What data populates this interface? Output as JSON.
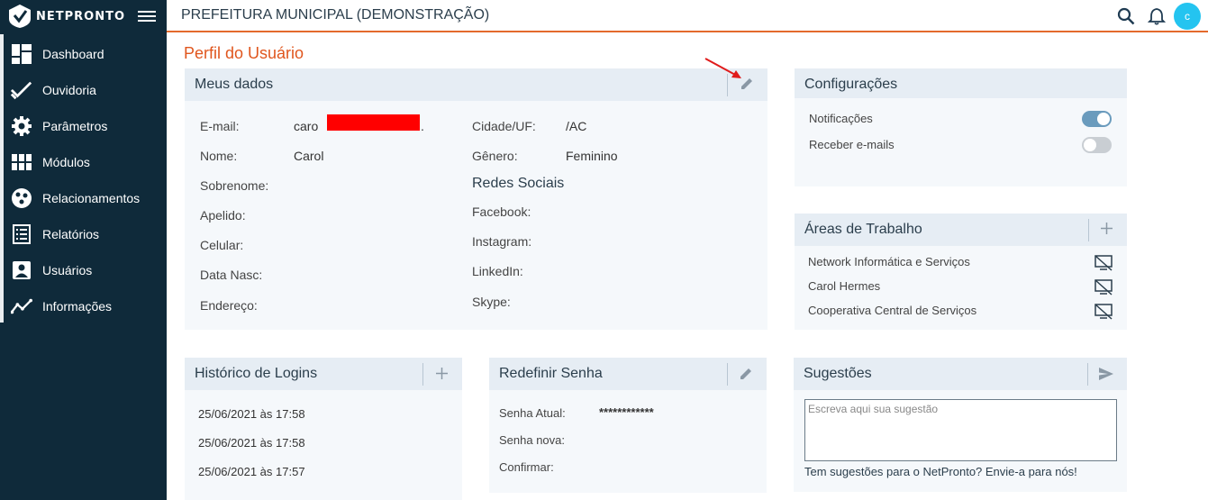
{
  "brand": {
    "name": "NETPRONTO"
  },
  "sidebar": {
    "items": [
      {
        "label": "Dashboard",
        "icon": "dashboard-icon"
      },
      {
        "label": "Ouvidoria",
        "icon": "checkmark-icon"
      },
      {
        "label": "Parâmetros",
        "icon": "gear-icon"
      },
      {
        "label": "Módulos",
        "icon": "grid-icon"
      },
      {
        "label": "Relacionamentos",
        "icon": "network-icon"
      },
      {
        "label": "Relatórios",
        "icon": "report-list-icon"
      },
      {
        "label": "Usuários",
        "icon": "user-icon"
      },
      {
        "label": "Informações",
        "icon": "line-chart-icon"
      }
    ]
  },
  "header": {
    "title": "PREFEITURA MUNICIPAL (DEMONSTRAÇÃO)",
    "avatar_letter": "c"
  },
  "page": {
    "title": "Perfil do Usuário"
  },
  "meus_dados": {
    "title": "Meus dados",
    "labels": {
      "email": "E-mail:",
      "nome": "Nome:",
      "sobrenome": "Sobrenome:",
      "apelido": "Apelido:",
      "celular": "Celular:",
      "data_nasc": "Data Nasc:",
      "endereco": "Endereço:",
      "cidade": "Cidade/UF:",
      "genero": "Gênero:"
    },
    "values": {
      "email_start": "caro",
      "email_end": ".",
      "nome": "Carol",
      "cidade": "/AC",
      "genero": "Feminino"
    },
    "redes_title": "Redes Sociais",
    "redes": {
      "facebook": "Facebook:",
      "instagram": "Instagram:",
      "linkedin": "LinkedIn:",
      "skype": "Skype:"
    }
  },
  "configuracoes": {
    "title": "Configurações",
    "items": [
      {
        "label": "Notificações",
        "on": true
      },
      {
        "label": "Receber e-mails",
        "on": false
      }
    ]
  },
  "areas": {
    "title": "Áreas de Trabalho",
    "items": [
      "Network Informática e Serviços",
      "Carol Hermes",
      "Cooperativa Central de Serviços"
    ]
  },
  "historico": {
    "title": "Histórico de Logins",
    "items": [
      "25/06/2021 às 17:58",
      "25/06/2021 às 17:58",
      "25/06/2021 às 17:57"
    ]
  },
  "senha": {
    "title": "Redefinir Senha",
    "atual_label": "Senha Atual:",
    "atual_value": "************",
    "nova_label": "Senha nova:",
    "confirmar_label": "Confirmar:"
  },
  "sugestoes": {
    "title": "Sugestões",
    "placeholder": "Escreva aqui sua sugestão",
    "footer": "Tem sugestões para o NetPronto? Envie-a para nós!"
  },
  "colors": {
    "accent": "#e46a2c",
    "sidebar": "#0f2a3a",
    "toggle_on": "#6a9bbd",
    "toggle_off": "#c9ced3",
    "redaction": "#ff0000",
    "annotation_arrow": "#e01b1b"
  }
}
